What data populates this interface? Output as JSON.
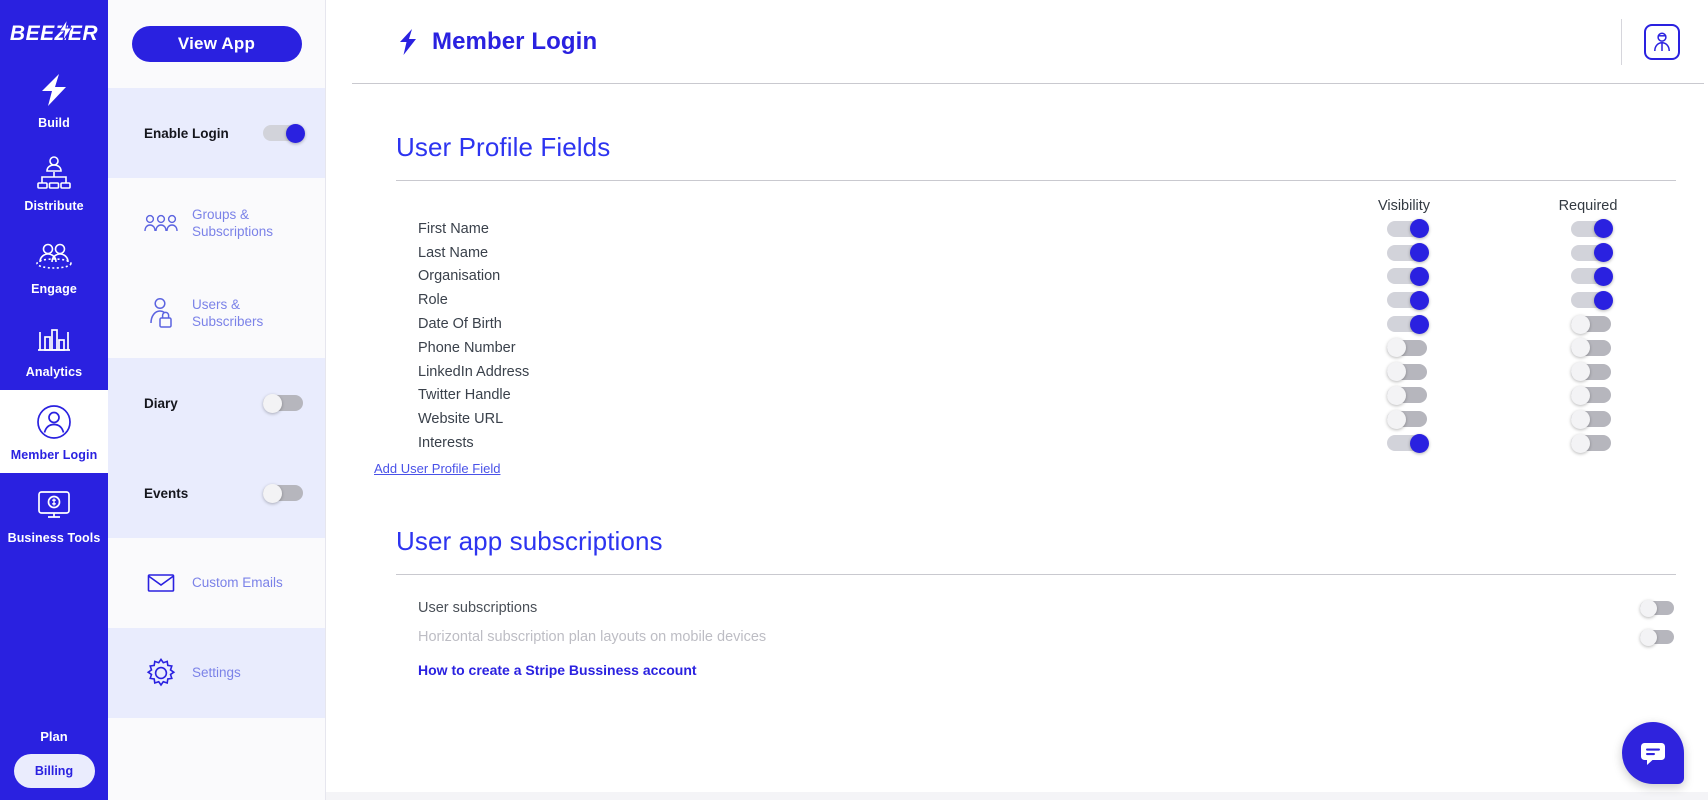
{
  "brand": {
    "name": "BEEZER",
    "accent": "#2a21e0",
    "accent_light": "#e9ecfd"
  },
  "rail": {
    "items": [
      {
        "label": "Build",
        "icon": "bolt-icon",
        "active": false
      },
      {
        "label": "Distribute",
        "icon": "distribute-icon",
        "active": false
      },
      {
        "label": "Engage",
        "icon": "engage-icon",
        "active": false
      },
      {
        "label": "Analytics",
        "icon": "analytics-icon",
        "active": false
      },
      {
        "label": "Member Login",
        "icon": "member-login-icon",
        "active": true
      },
      {
        "label": "Business Tools",
        "icon": "business-tools-icon",
        "active": false
      }
    ],
    "plan_label": "Plan",
    "billing_label": "Billing"
  },
  "panel": {
    "view_app_label": "View App",
    "rows": [
      {
        "type": "toggle",
        "label": "Enable Login",
        "state": "on",
        "tinted": true
      },
      {
        "type": "nav",
        "label": "Groups & Subscriptions",
        "icon": "groups-icon",
        "tinted": false
      },
      {
        "type": "nav",
        "label": "Users & Subscribers",
        "icon": "user-lock-icon",
        "tinted": false
      },
      {
        "type": "toggle",
        "label": "Diary",
        "state": "off",
        "tinted": true
      },
      {
        "type": "toggle",
        "label": "Events",
        "state": "off",
        "tinted": true
      },
      {
        "type": "nav",
        "label": "Custom Emails",
        "icon": "envelope-icon",
        "tinted": false
      },
      {
        "type": "nav",
        "label": "Settings",
        "icon": "gear-icon",
        "tinted": true
      }
    ]
  },
  "header": {
    "title": "Member Login",
    "title_icon": "bolt-icon",
    "avatar_icon": "user-avatar-icon"
  },
  "profile_section": {
    "title": "User Profile Fields",
    "columns": [
      "Visibility",
      "Required"
    ],
    "fields": [
      {
        "name": "First Name",
        "visibility": "on",
        "required": "on"
      },
      {
        "name": "Last Name",
        "visibility": "on",
        "required": "on"
      },
      {
        "name": "Organisation",
        "visibility": "on",
        "required": "on"
      },
      {
        "name": "Role",
        "visibility": "on",
        "required": "on"
      },
      {
        "name": "Date Of Birth",
        "visibility": "on",
        "required": "off"
      },
      {
        "name": "Phone Number",
        "visibility": "off",
        "required": "off"
      },
      {
        "name": "LinkedIn Address",
        "visibility": "off",
        "required": "off"
      },
      {
        "name": "Twitter Handle",
        "visibility": "off",
        "required": "off"
      },
      {
        "name": "Website URL",
        "visibility": "off",
        "required": "off"
      },
      {
        "name": "Interests",
        "visibility": "on",
        "required": "off"
      }
    ],
    "add_link": "Add User Profile Field"
  },
  "subscriptions_section": {
    "title": "User app subscriptions",
    "rows": [
      {
        "label": "User subscriptions",
        "state": "off",
        "muted": false
      },
      {
        "label": "Horizontal subscription plan layouts on mobile devices",
        "state": "off",
        "muted": true
      }
    ],
    "stripe_link": "How to create a Stripe Bussiness account"
  },
  "chat": {
    "icon": "chat-icon"
  }
}
